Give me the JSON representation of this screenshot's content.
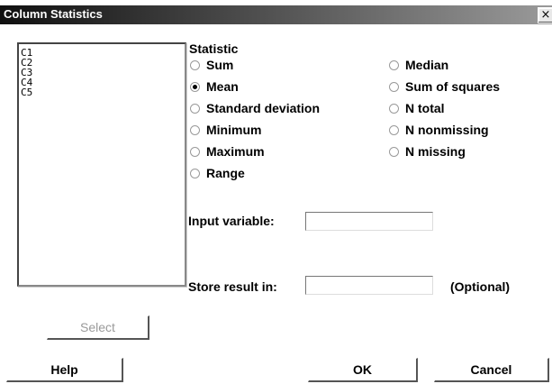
{
  "window": {
    "title": "Column Statistics",
    "close_glyph": "×"
  },
  "columns_list": {
    "items": [
      "C1",
      "C2",
      "C3",
      "C4",
      "C5"
    ]
  },
  "statistic": {
    "heading": "Statistic",
    "options": [
      {
        "label": "Sum",
        "checked": false
      },
      {
        "label": "Mean",
        "checked": true
      },
      {
        "label": "Standard deviation",
        "checked": false
      },
      {
        "label": "Minimum",
        "checked": false
      },
      {
        "label": "Maximum",
        "checked": false
      },
      {
        "label": "Range",
        "checked": false
      },
      {
        "label": "Median",
        "checked": false
      },
      {
        "label": "Sum of squares",
        "checked": false
      },
      {
        "label": "N total",
        "checked": false
      },
      {
        "label": "N nonmissing",
        "checked": false
      },
      {
        "label": "N missing",
        "checked": false
      }
    ]
  },
  "input_variable": {
    "label": "Input variable:",
    "value": ""
  },
  "store_result": {
    "label": "Store result in:",
    "value": "",
    "hint": "(Optional)"
  },
  "buttons": {
    "select": "Select",
    "help": "Help",
    "ok": "OK",
    "cancel": "Cancel"
  }
}
